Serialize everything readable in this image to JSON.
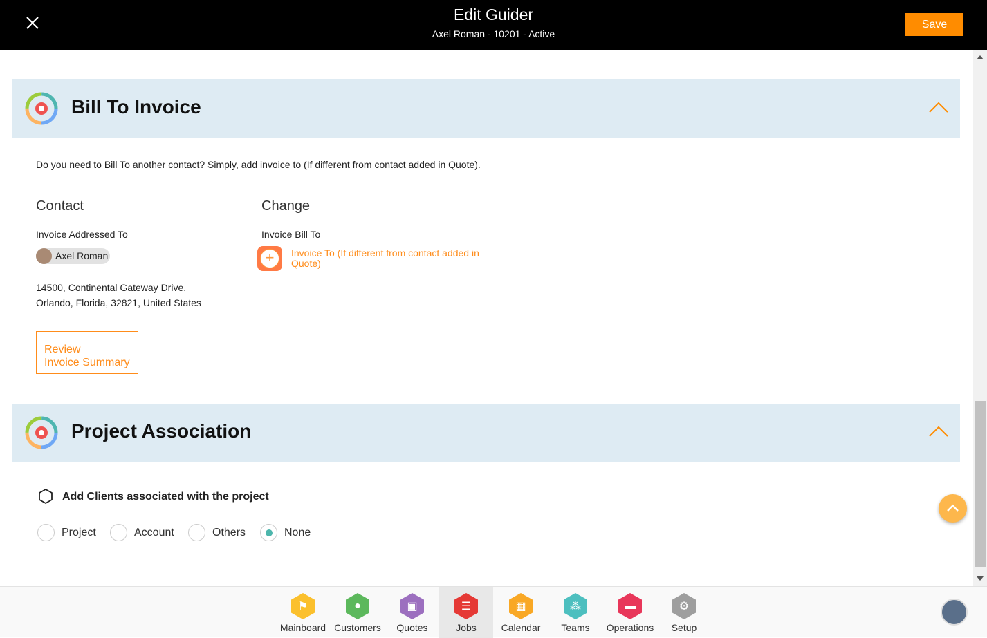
{
  "header": {
    "title": "Edit Guider",
    "subtitle": "Axel Roman - 10201 - Active",
    "save_label": "Save"
  },
  "bill": {
    "title": "Bill To Invoice",
    "intro": "Do you need to Bill To another contact? Simply, add invoice to (If different from contact added in Quote).",
    "contact_heading": "Contact",
    "addressed_label": "Invoice Addressed To",
    "contact_name": "Axel Roman",
    "address_line1": "14500, Continental Gateway Drive,",
    "address_line2": "Orlando, Florida, 32821, United States",
    "change_heading": "Change",
    "bill_to_label": "Invoice Bill To",
    "add_invoice_label": "Invoice To (If different from contact added in Quote)",
    "review_line1": "Review",
    "review_line2": "Invoice Summary"
  },
  "project": {
    "title": "Project Association",
    "add_clients_label": "Add Clients associated with the project",
    "options": [
      "Project",
      "Account",
      "Others",
      "None"
    ],
    "selected": "None"
  },
  "nav": {
    "items": [
      "Mainboard",
      "Customers",
      "Quotes",
      "Jobs",
      "Calendar",
      "Teams",
      "Operations",
      "Setup"
    ],
    "active": "Jobs",
    "colors": [
      "#fbc02d",
      "#5cb85c",
      "#9c6fbf",
      "#e53935",
      "#f9a825",
      "#4dbfbf",
      "#e8375a",
      "#9e9e9e"
    ]
  },
  "colors": {
    "accent": "#ff8c00",
    "section_bg": "#deebf3"
  }
}
